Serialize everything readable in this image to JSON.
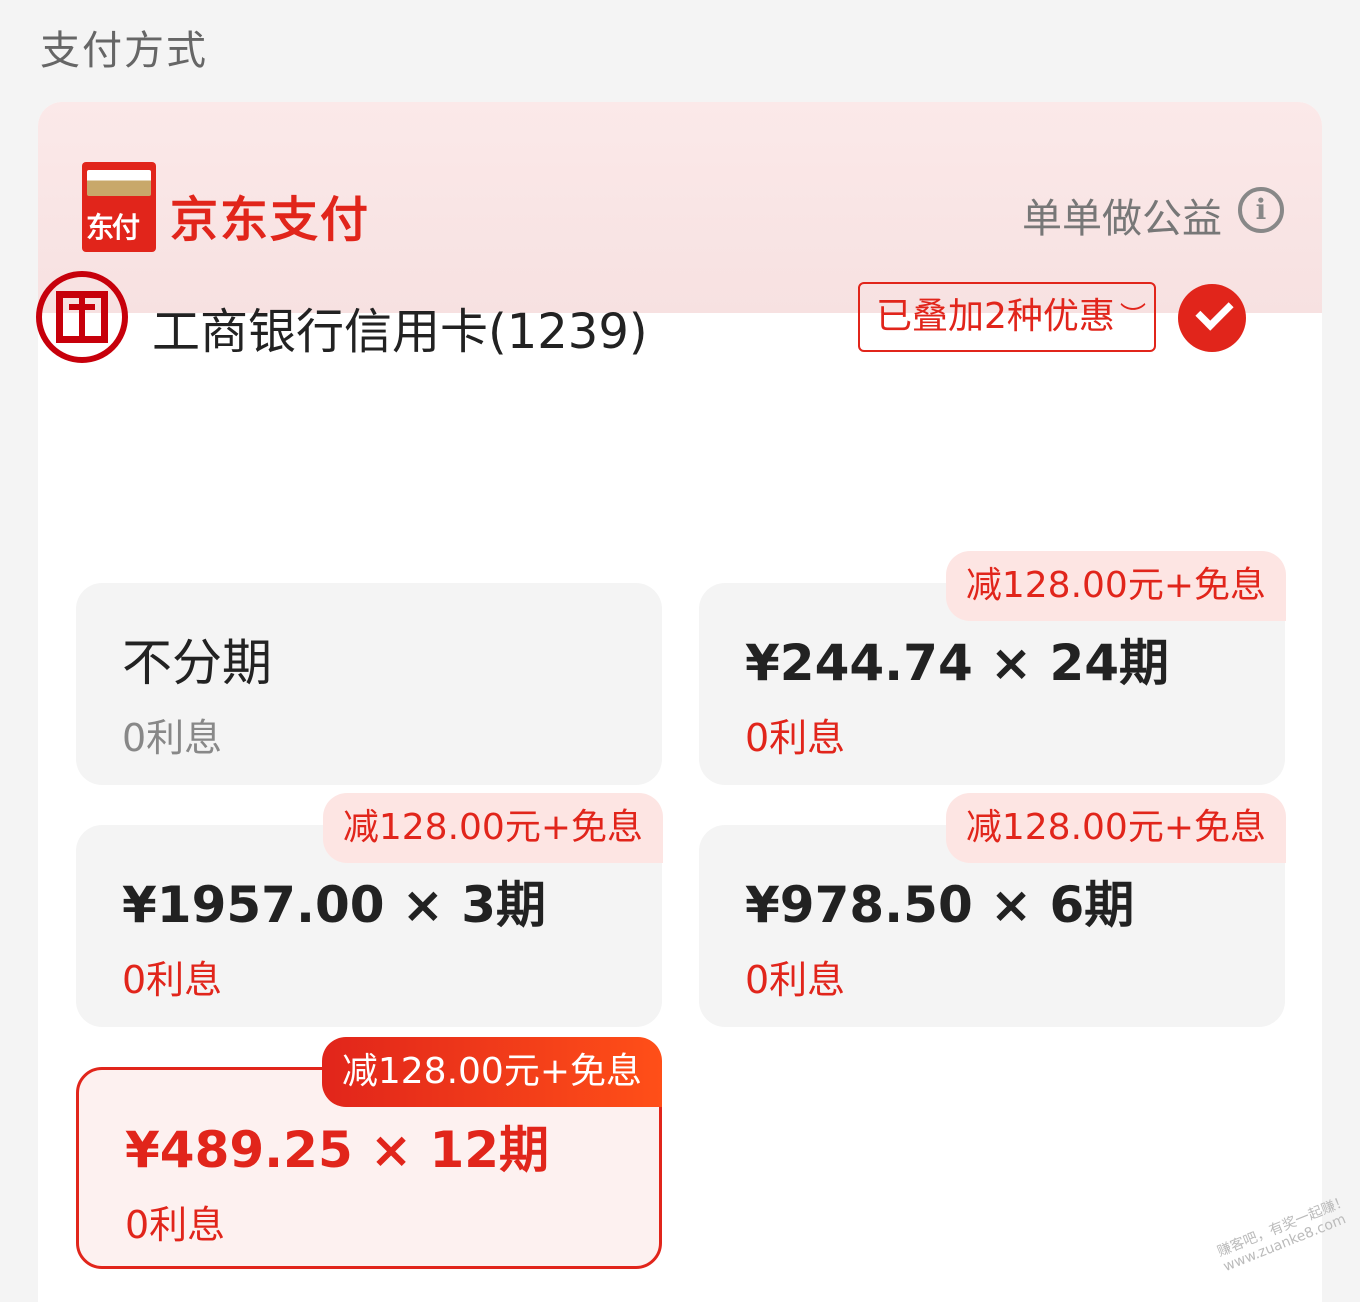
{
  "section_title": "支付方式",
  "header": {
    "logo_text": "东付",
    "brand": "京东支付",
    "charity": "单单做公益"
  },
  "card": {
    "bank_name": "工商银行信用卡(1239)",
    "discount_label": "已叠加2种优惠",
    "selected": true
  },
  "options": [
    {
      "main": "不分期",
      "sub": "0利息",
      "tag": ""
    },
    {
      "main": "¥244.74 × 24期",
      "sub": "0利息",
      "tag": "减128.00元+免息"
    },
    {
      "main": "¥1957.00 × 3期",
      "sub": "0利息",
      "tag": "减128.00元+免息"
    },
    {
      "main": "¥978.50 × 6期",
      "sub": "0利息",
      "tag": "减128.00元+免息"
    },
    {
      "main": "¥489.25 × 12期",
      "sub": "0利息",
      "tag": "减128.00元+免息",
      "selected": true
    }
  ],
  "watermark": [
    "赚客吧，有奖一起赚！",
    "www.zuanke8.com"
  ],
  "colors": {
    "accent": "#e1251b",
    "bank": "#c7000b",
    "header_bg": "#f8e4e4"
  },
  "icons": [
    "info-icon",
    "check-icon",
    "chevron-down-icon",
    "icbc-logo-icon",
    "jdpay-logo-icon"
  ]
}
